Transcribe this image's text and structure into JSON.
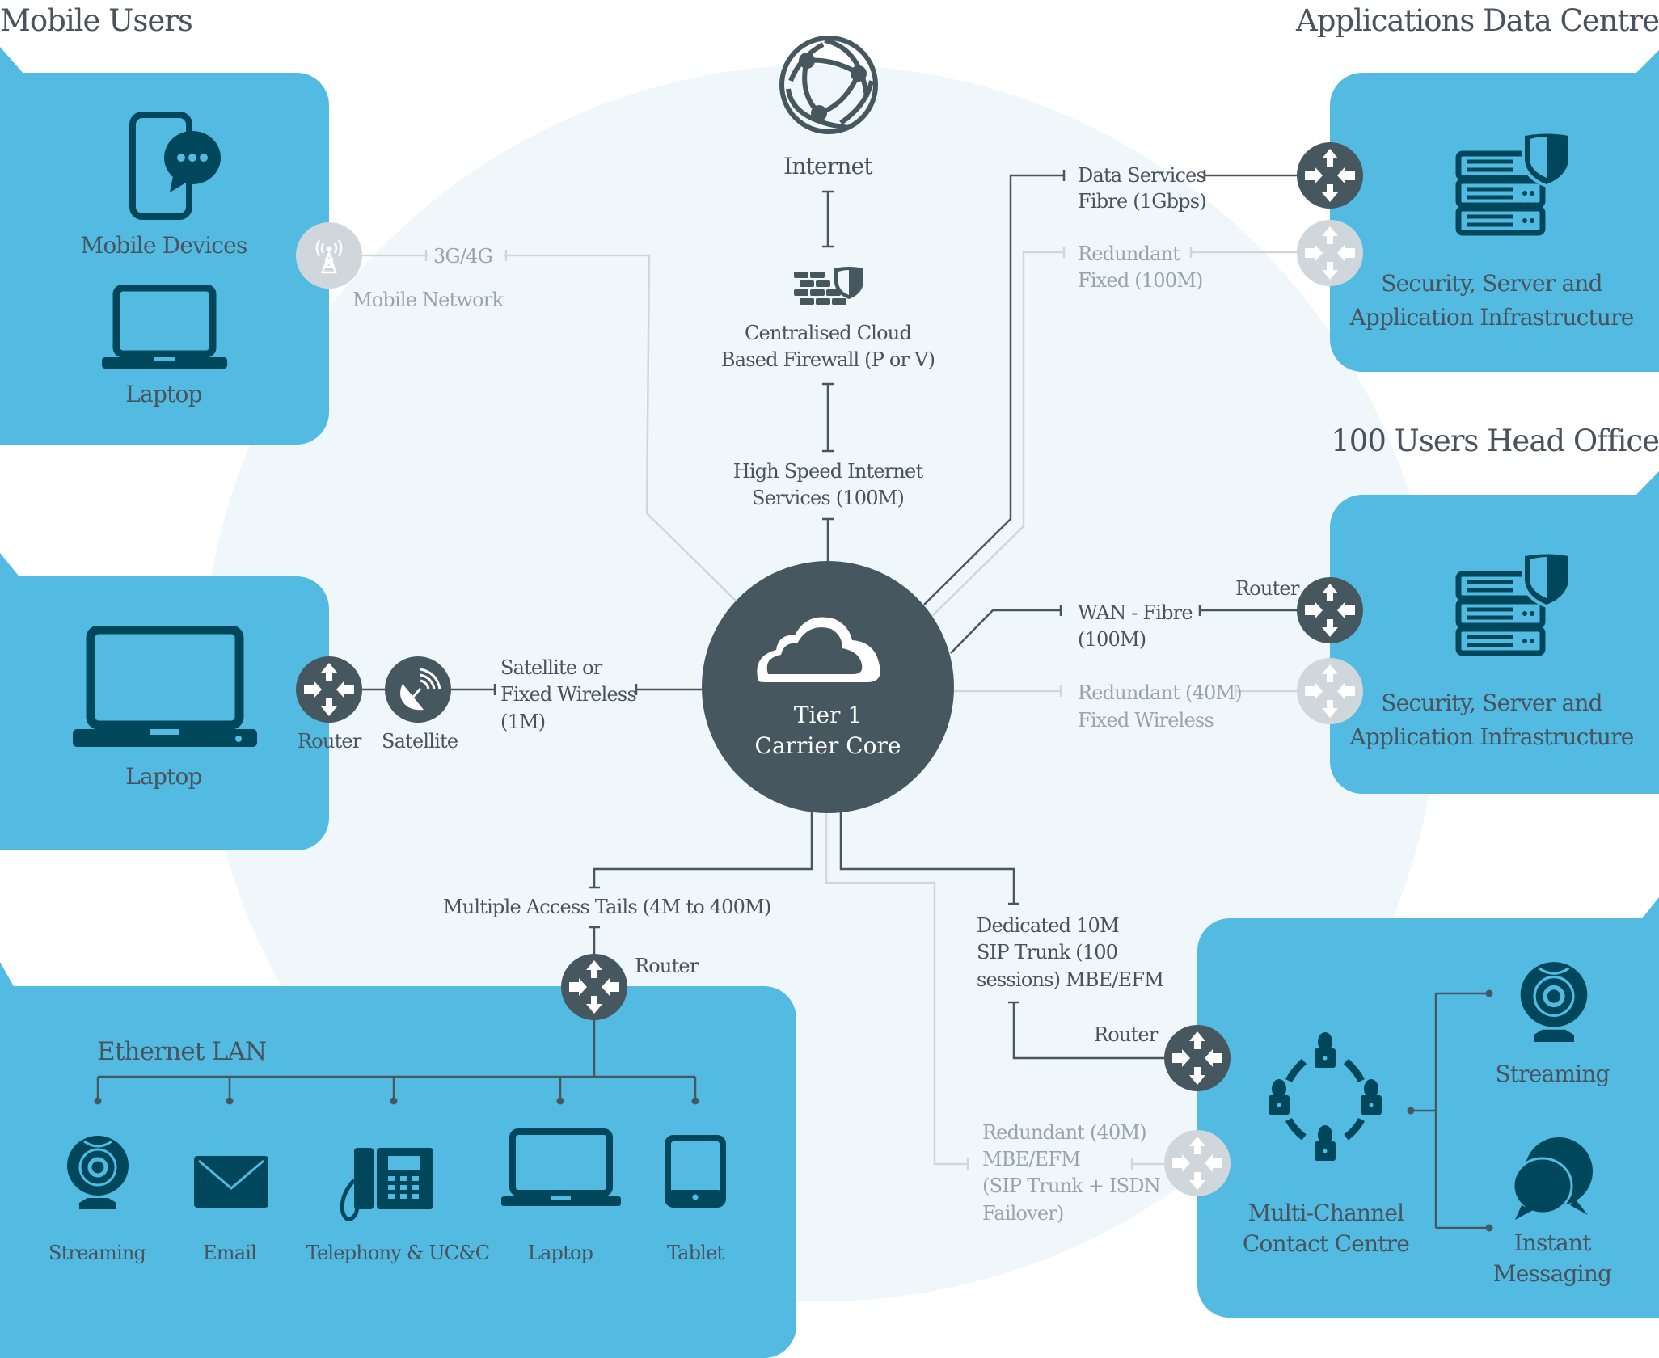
{
  "sections": {
    "mobile_users": "Mobile Users",
    "applications_data_centre": "Applications Data Centre",
    "head_office": "100 Users Head Office"
  },
  "mobile_box": {
    "devices": "Mobile Devices",
    "laptop": "Laptop"
  },
  "mobile_network": {
    "link": "3G/4G",
    "label": "Mobile Network"
  },
  "remote_box": {
    "laptop": "Laptop",
    "router": "Router",
    "satellite": "Satellite",
    "link_line1": "Satellite or",
    "link_line2": "Fixed Wireless",
    "link_line3": "(1M)"
  },
  "internet": {
    "label": "Internet",
    "firewall_line1": "Centralised Cloud",
    "firewall_line2": "Based Firewall (P or V)",
    "his_line1": "High Speed Internet",
    "his_line2": "Services (100M)"
  },
  "core": {
    "line1": "Tier 1",
    "line2": "Carrier Core"
  },
  "data_centre": {
    "primary_line1": "Data Services",
    "primary_line2": "Fibre (1Gbps)",
    "redundant_line1": "Redundant",
    "redundant_line2": "Fixed (100M)",
    "box_line1": "Security, Server and",
    "box_line2": "Application Infrastructure"
  },
  "head_office": {
    "router": "Router",
    "primary_line1": "WAN - Fibre",
    "primary_line2": "(100M)",
    "redundant_line1": "Redundant (40M)",
    "redundant_line2": "Fixed Wireless",
    "box_line1": "Security, Server and",
    "box_line2": "Application Infrastructure"
  },
  "access_tails": {
    "label": "Multiple Access Tails (4M to 400M)",
    "router": "Router"
  },
  "ethernet_lan": {
    "title": "Ethernet LAN",
    "devices": [
      "Streaming",
      "Email",
      "Telephony & UC&C",
      "Laptop",
      "Tablet"
    ]
  },
  "sip": {
    "primary_line1": "Dedicated 10M",
    "primary_line2": "SIP Trunk (100",
    "primary_line3": "sessions) MBE/EFM",
    "router": "Router",
    "redundant_line1": "Redundant (40M)",
    "redundant_line2": "MBE/EFM",
    "redundant_line3": "(SIP Trunk + ISDN",
    "redundant_line4": "Failover)"
  },
  "contact_centre": {
    "line1": "Multi-Channel",
    "line2": "Contact Centre",
    "streaming": "Streaming",
    "im_line1": "Instant",
    "im_line2": "Messaging"
  },
  "colors": {
    "box_blue": "#53bbe1",
    "icon_dark": "#00475b",
    "node_dark": "#47575f",
    "node_light": "#d0d7dc",
    "line_dark": "#47575f",
    "line_light": "#d0d7dc",
    "text": "#48535e",
    "text_muted": "#98a4ad",
    "bg_circle": "#eff7fa"
  }
}
